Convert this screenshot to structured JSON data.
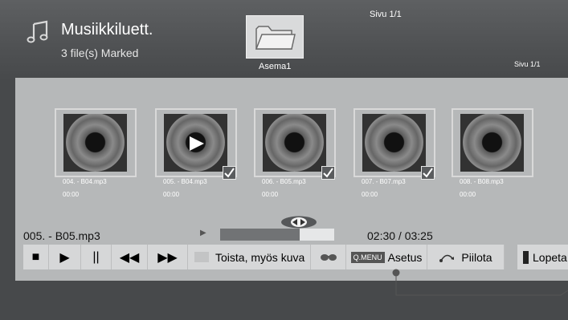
{
  "header": {
    "title": "Musiikkiluett.",
    "subtitle": "3 file(s) Marked",
    "page_top": "Sivu 1/1",
    "page_right": "Sivu 1/1",
    "drive_label": "Asema1"
  },
  "files": [
    {
      "name": "004. - B04.mp3",
      "time": "00:00",
      "checked": false,
      "playing": false
    },
    {
      "name": "005. - B04.mp3",
      "time": "00:00",
      "checked": true,
      "playing": true
    },
    {
      "name": "006. - B05.mp3",
      "time": "00:00",
      "checked": true,
      "playing": false
    },
    {
      "name": "007. - B07.mp3",
      "time": "00:00",
      "checked": true,
      "playing": false
    },
    {
      "name": "008. - B08.mp3",
      "time": "00:00",
      "checked": false,
      "playing": false
    }
  ],
  "player": {
    "now_playing": "005. - B05.mp3",
    "time": "02:30 / 03:25",
    "progress": 0.7
  },
  "controls": {
    "stop": "■",
    "play": "▶",
    "pause": "||",
    "rewind": "◀◀",
    "forward": "▶▶",
    "play_with_photo": "Toista, myös kuva",
    "qmenu_tag": "Q.MENU",
    "settings": "Asetus",
    "hide": "Piilota",
    "exit": "Lopeta"
  },
  "colors": {
    "screen_bg": "#4f5153",
    "panel_bg": "#b6b8b9",
    "button_bg": "#d6d7d8",
    "progress_fill": "#717375"
  }
}
